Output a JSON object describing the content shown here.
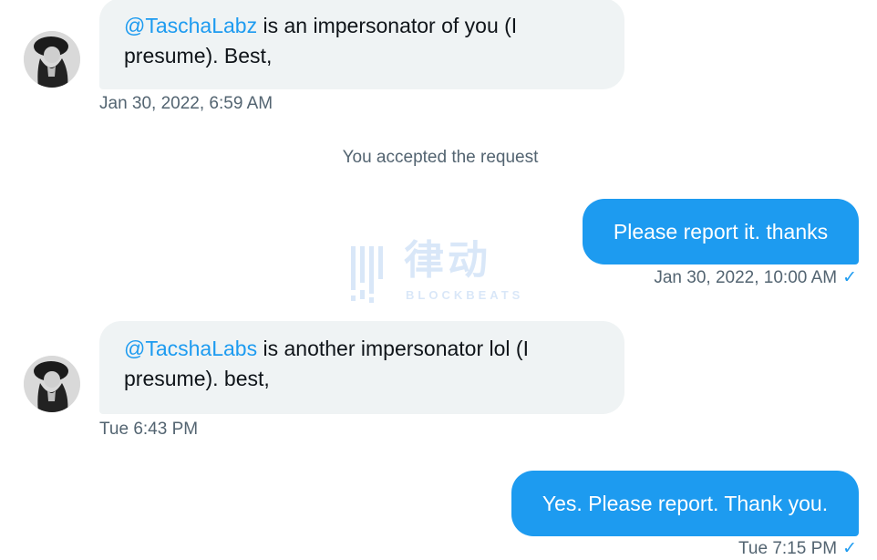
{
  "messages": [
    {
      "mention": "@TaschaLabz",
      "text": " is an impersonator of you (I presume).  Best,",
      "timestamp": "Jan 30, 2022, 6:59 AM"
    },
    {
      "text": "Please report it. thanks",
      "timestamp": "Jan 30, 2022, 10:00 AM"
    },
    {
      "mention": "@TacshaLabs",
      "text": " is another impersonator lol (I presume).  best,",
      "timestamp": "Tue 6:43 PM"
    },
    {
      "text": "Yes. Please report. Thank you.",
      "timestamp": "Tue 7:15 PM"
    }
  ],
  "notice": "You accepted the request",
  "watermark": {
    "cn": "律动",
    "en": "BLOCKBEATS"
  },
  "icons": {
    "read_receipt": "check-icon",
    "avatar": "user-avatar-photo"
  },
  "colors": {
    "outgoing_bubble": "#1d9bf0",
    "incoming_bubble": "#eff3f4",
    "mention": "#1d9bf0",
    "timestamp": "#536471"
  }
}
